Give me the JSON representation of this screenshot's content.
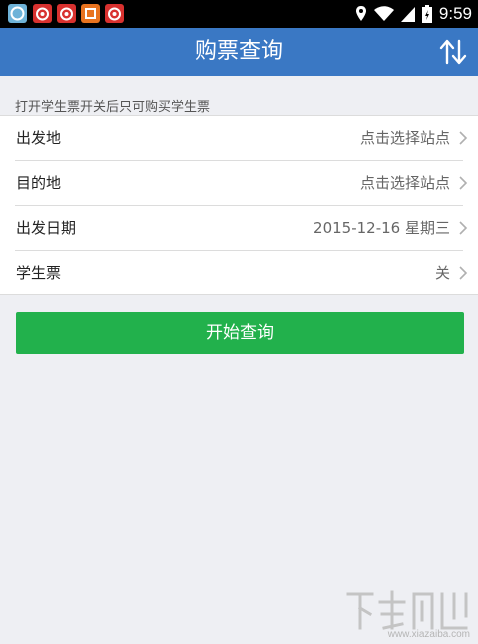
{
  "status_bar": {
    "time": "9:59",
    "icons": [
      "app-icon-1",
      "app-icon-2",
      "app-icon-3",
      "app-icon-4",
      "app-icon-5",
      "location-icon",
      "wifi-icon",
      "signal-icon",
      "battery-icon"
    ]
  },
  "header": {
    "title": "购票查询",
    "swap_icon": "swap-vertical-icon",
    "color": "#3a78c4"
  },
  "hint": "打开学生票开关后只可购买学生票",
  "form": {
    "rows": [
      {
        "label": "出发地",
        "value": "点击选择站点"
      },
      {
        "label": "目的地",
        "value": "点击选择站点"
      },
      {
        "label": "出发日期",
        "value": "2015-12-16 星期三"
      },
      {
        "label": "学生票",
        "value": "关"
      }
    ]
  },
  "search_button": {
    "label": "开始查询",
    "color": "#22b14c"
  },
  "watermark": {
    "site": "www.xiazaiba.com"
  }
}
